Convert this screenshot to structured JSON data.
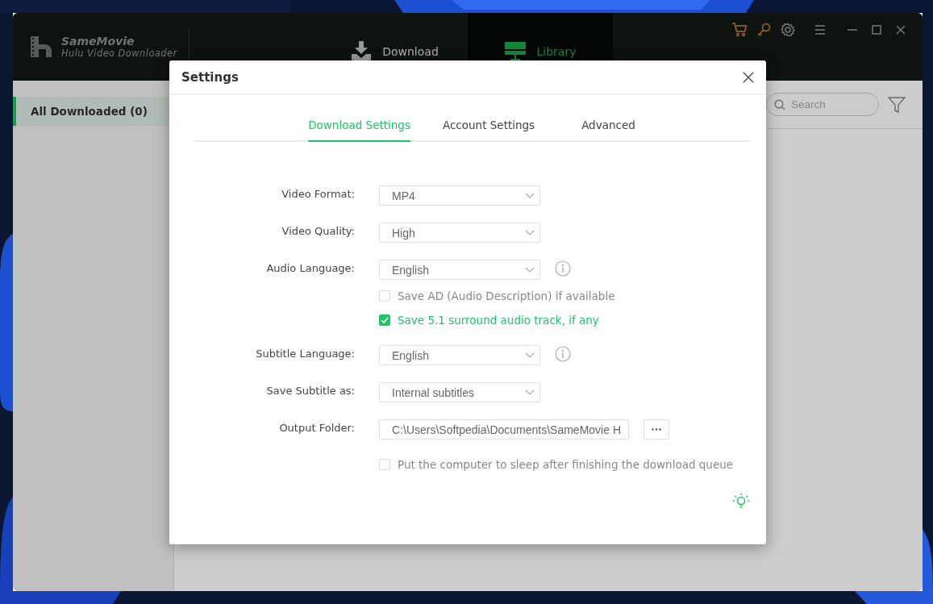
{
  "app": {
    "logo": {
      "name": "SameMovie",
      "subtitle": "Hulu Video Downloader"
    },
    "nav_tabs": [
      {
        "label": "Download",
        "kind": "download",
        "selected": false
      },
      {
        "label": "Library",
        "kind": "library",
        "selected": true
      }
    ],
    "sidebar": {
      "items": [
        {
          "label": "All Downloaded (0)",
          "selected": true
        }
      ]
    },
    "search": {
      "placeholder": "Search"
    }
  },
  "dialog": {
    "title": "Settings",
    "tabs": [
      {
        "label": "Download Settings",
        "selected": true
      },
      {
        "label": "Account Settings",
        "selected": false
      },
      {
        "label": "Advanced",
        "selected": false
      }
    ],
    "rows": [
      {
        "kind": "select",
        "label": "Video Format:",
        "value": "MP4",
        "info": false
      },
      {
        "kind": "select",
        "label": "Video Quality:",
        "value": "High",
        "info": false
      },
      {
        "kind": "select",
        "label": "Audio Language:",
        "value": "English",
        "info": true,
        "options": [
          {
            "label": "Save AD (Audio Description) if available",
            "checked": false
          },
          {
            "label": "Save 5.1 surround audio track, if any",
            "checked": true
          }
        ]
      },
      {
        "kind": "select",
        "label": "Subtitle Language:",
        "value": "English",
        "info": true
      },
      {
        "kind": "select",
        "label": "Save Subtitle as:",
        "value": "Internal subtitles",
        "info": false
      },
      {
        "kind": "folder",
        "label": "Output Folder:",
        "value": "C:\\Users\\Softpedia\\Documents\\SameMovie H"
      },
      {
        "kind": "checkbox",
        "label": "Put the computer to sleep after finishing the download queue",
        "checked": false
      }
    ]
  }
}
